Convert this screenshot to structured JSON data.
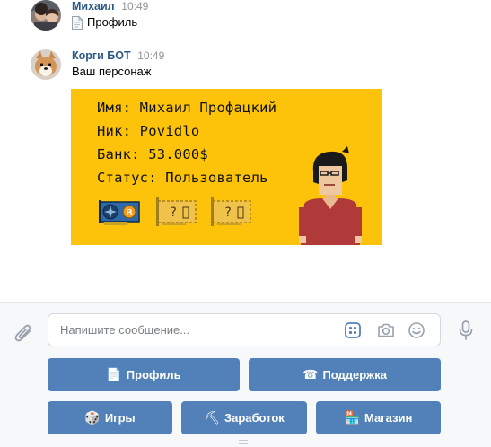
{
  "messages": [
    {
      "author": "Михаил",
      "time": "10:49",
      "text": "Профиль",
      "has_doc_icon": true
    },
    {
      "author": "Корги БОТ",
      "time": "10:49",
      "text": "Ваш персонаж"
    }
  ],
  "card": {
    "lines": [
      "Имя: Михаил Профацкий",
      "Ник: Povidlo",
      "Банк: 53.000$",
      "Статус: Пользователь"
    ],
    "background": "#fcc30a",
    "items": [
      "gpu-card-icon",
      "mystery-card-icon",
      "mystery-card-icon"
    ]
  },
  "composer": {
    "placeholder": "Напишите сообщение..."
  },
  "keyboard": {
    "rows": [
      [
        {
          "icon": "📄",
          "label": "Профиль"
        },
        {
          "icon": "☎",
          "label": "Поддержка"
        }
      ],
      [
        {
          "icon": "🎲",
          "label": "Игры"
        },
        {
          "icon": "⛏",
          "label": "Заработок"
        },
        {
          "icon": "🏪",
          "label": "Магазин"
        }
      ]
    ],
    "button_color": "#5181b8"
  },
  "colors": {
    "author": "#2a5885",
    "time": "#939393"
  }
}
